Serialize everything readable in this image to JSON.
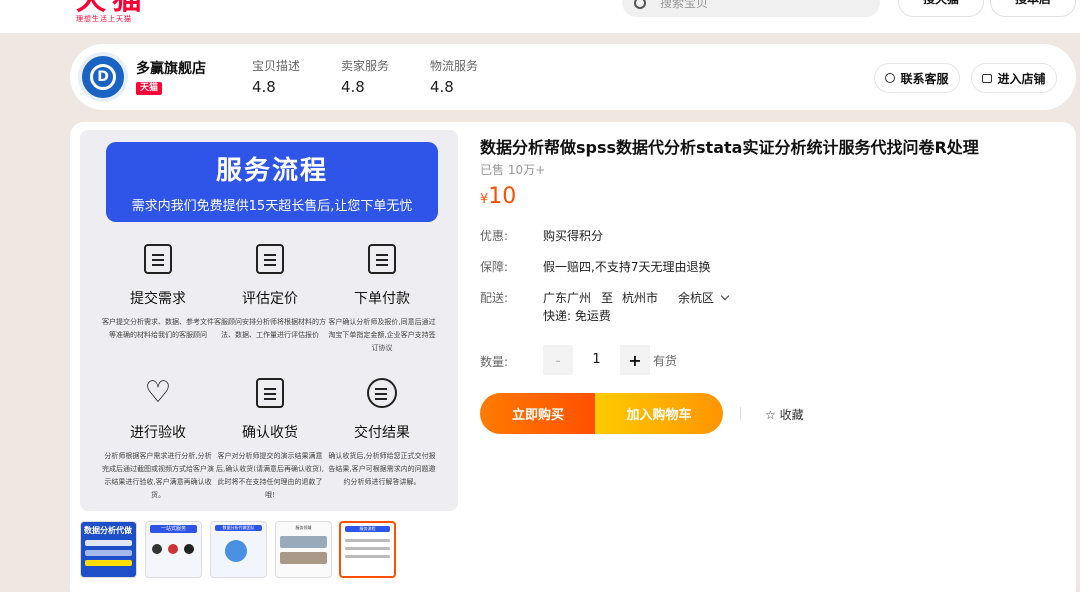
{
  "header": {
    "logo": "天猫",
    "logo_slogan": "理想生活上天猫",
    "search_placeholder": "搜索宝贝",
    "btn_search_tmall": "搜天猫",
    "btn_search_store": "搜本店"
  },
  "shop": {
    "name": "多赢旗舰店",
    "badge": "天猫",
    "ratings": [
      {
        "label": "宝贝描述",
        "value": "4.8"
      },
      {
        "label": "卖家服务",
        "value": "4.8"
      },
      {
        "label": "物流服务",
        "value": "4.8"
      }
    ],
    "contact_label": "联系客服",
    "enter_label": "进入店铺"
  },
  "service_image": {
    "title": "服务流程",
    "subtitle": "需求内我们免费提供15天超长售后,让您下单无忧",
    "steps": [
      {
        "title": "提交需求",
        "icon": "edit-doc-icon",
        "desc": "客户提交分析需求、数据、参考文件等准确的材料给我们的客服顾问"
      },
      {
        "title": "评估定价",
        "icon": "evaluate-icon",
        "desc": "客服顾问安排分析师将根据材料的方法、数据、工作量进行评估报价"
      },
      {
        "title": "下单付款",
        "icon": "checklist-icon",
        "desc": "客户确认分析师及报价,同意后通过淘宝下单指定金额,企业客户支持签订协议"
      },
      {
        "title": "进行验收",
        "icon": "heart-icon",
        "desc": "分析师根据客户需求进行分析,分析完成后通过截图或视频方式给客户演示结果进行验收,客户满意再确认收货。"
      },
      {
        "title": "确认收货",
        "icon": "receipt-check-icon",
        "desc": "客户对分析师提交的演示结果满意后,确认收货(请满意后再确认收货),此时将不在支持任何理由的退款了哦!"
      },
      {
        "title": "交付结果",
        "icon": "list-check-icon",
        "desc": "确认收货后,分析师给您正式交付报告结果,客户可根据需求内的问题邀约分析师进行解答讲解。"
      }
    ]
  },
  "thumbnails": [
    {
      "label": "数据分析代做"
    },
    {
      "label": "一站式服务"
    },
    {
      "label": "数据分析代做团队"
    },
    {
      "label": "服务领域"
    },
    {
      "label": "服务流程"
    }
  ],
  "product": {
    "title": "数据分析帮做spss数据代分析stata实证分析统计服务代找问卷R处理",
    "sold": "已售 10万+",
    "currency": "¥",
    "price": "10",
    "promo_label": "优惠:",
    "promo_value": "购买得积分",
    "guarantee_label": "保障:",
    "guarantee_value": "假一赔四,不支持7天无理由退换",
    "ship_label": "配送:",
    "ship_from": "广东广州",
    "ship_to_word": "至",
    "ship_city": "杭州市",
    "ship_district": "余杭区",
    "ship_fee": "快递: 免运费",
    "qty_label": "数量:",
    "qty_value": "1",
    "qty_minus": "-",
    "qty_plus": "+",
    "stock": "有货",
    "buy_now": "立即购买",
    "add_cart": "加入购物车",
    "favorite": "☆ 收藏"
  },
  "colors": {
    "brand_red": "#ff0036",
    "price_orange": "#ff5000",
    "service_blue": "#2f55e8"
  }
}
